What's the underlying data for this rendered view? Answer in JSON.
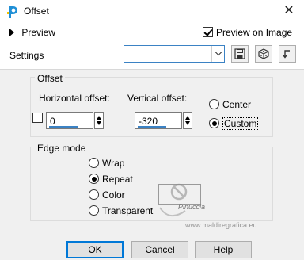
{
  "window": {
    "title": "Offset",
    "close_glyph": "✕",
    "icon": "paint-palette-icon"
  },
  "top": {
    "preview_label": "Preview",
    "preview_on_image_label": "Preview on Image",
    "preview_on_image_checked": true,
    "settings_label": "Settings",
    "settings_value": ""
  },
  "offset": {
    "group_label": "Offset",
    "horizontal_label": "Horizontal offset:",
    "horizontal_value": "0",
    "vertical_label": "Vertical offset:",
    "vertical_value": "-320",
    "link_checked": false,
    "center_label": "Center",
    "custom_label": "Custom",
    "selected": "custom"
  },
  "edge_mode": {
    "group_label": "Edge mode",
    "options": [
      "Wrap",
      "Repeat",
      "Color",
      "Transparent"
    ],
    "selected": "Repeat"
  },
  "watermark": {
    "line1": "Pinuccia",
    "line2": "www.maldiregrafica.eu"
  },
  "buttons": {
    "ok": "OK",
    "cancel": "Cancel",
    "help": "Help"
  },
  "colors": {
    "accent": "#0078d7",
    "panel_bg": "#f0f0f0"
  }
}
